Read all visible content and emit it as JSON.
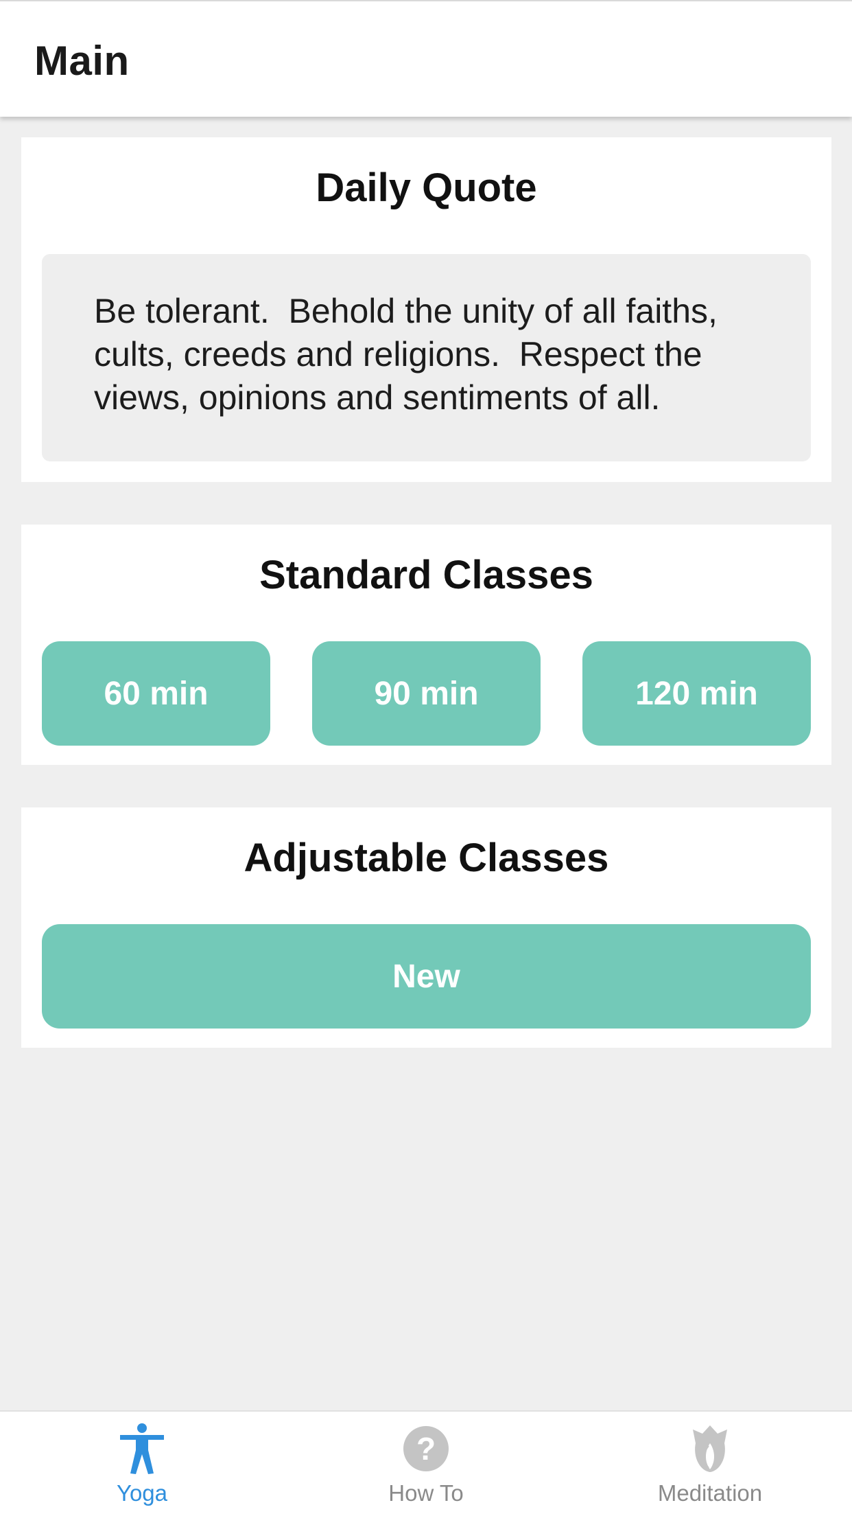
{
  "header": {
    "title": "Main"
  },
  "daily_quote": {
    "title": "Daily Quote",
    "text": "Be tolerant.  Behold the unity of all faiths, cults, creeds and religions.  Respect the views, opinions and sentiments of all."
  },
  "standard_classes": {
    "title": "Standard Classes",
    "buttons": [
      {
        "label": "60 min"
      },
      {
        "label": "90 min"
      },
      {
        "label": "120 min"
      }
    ]
  },
  "adjustable_classes": {
    "title": "Adjustable Classes",
    "new_label": "New"
  },
  "tabbar": {
    "items": [
      {
        "label": "Yoga",
        "icon": "yoga-person-icon",
        "active": true
      },
      {
        "label": "How To",
        "icon": "question-circle-icon",
        "active": false
      },
      {
        "label": "Meditation",
        "icon": "lotus-icon",
        "active": false
      }
    ]
  },
  "colors": {
    "accent_button": "#73c9b8",
    "tab_active": "#2f8fdd",
    "tab_inactive": "#8a8a8a",
    "background": "#efefef"
  }
}
